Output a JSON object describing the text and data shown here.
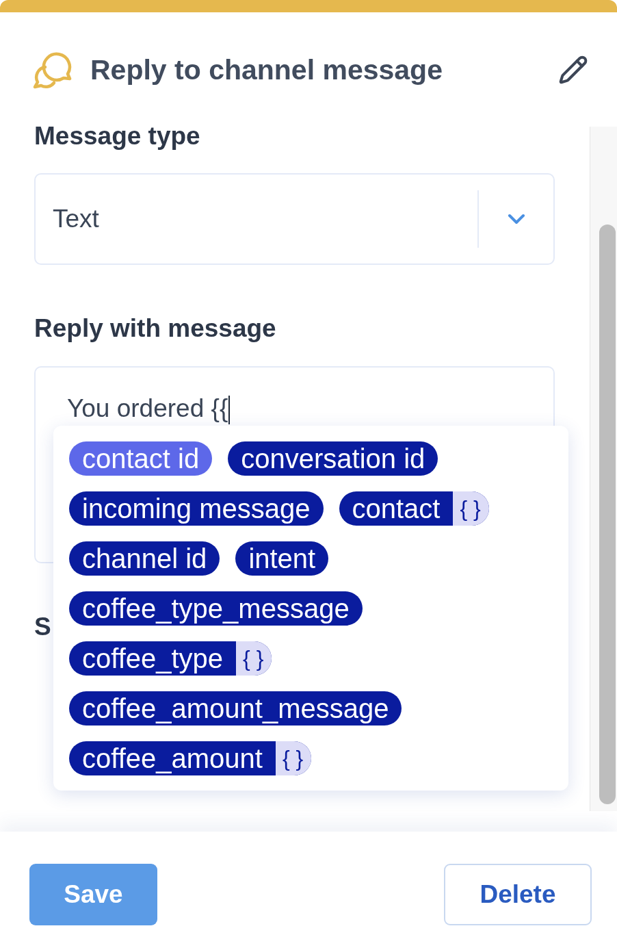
{
  "header": {
    "title": "Reply to channel message"
  },
  "message_type": {
    "label": "Message type",
    "value": "Text"
  },
  "reply": {
    "label": "Reply with message",
    "value": "You ordered {{",
    "focused": true,
    "suggestions": [
      {
        "label": "contact id",
        "selected": true
      },
      {
        "label": "conversation id",
        "selected": false
      },
      {
        "label": "incoming message",
        "selected": false
      },
      {
        "label": "contact",
        "selected": false,
        "suffix": "{ }"
      },
      {
        "label": "channel id",
        "selected": false
      },
      {
        "label": "intent",
        "selected": false
      },
      {
        "label": "coffee_type_message",
        "selected": false
      },
      {
        "label": "coffee_type",
        "selected": false,
        "suffix": "{ }"
      },
      {
        "label": "coffee_amount_message",
        "selected": false
      },
      {
        "label": "coffee_amount",
        "selected": false,
        "suffix": "{ }"
      }
    ]
  },
  "field_3": {
    "label": "S"
  },
  "buttons": [
    {
      "label": "Save",
      "kind": "primary"
    },
    {
      "label": "Delete",
      "kind": "secondary"
    }
  ]
}
